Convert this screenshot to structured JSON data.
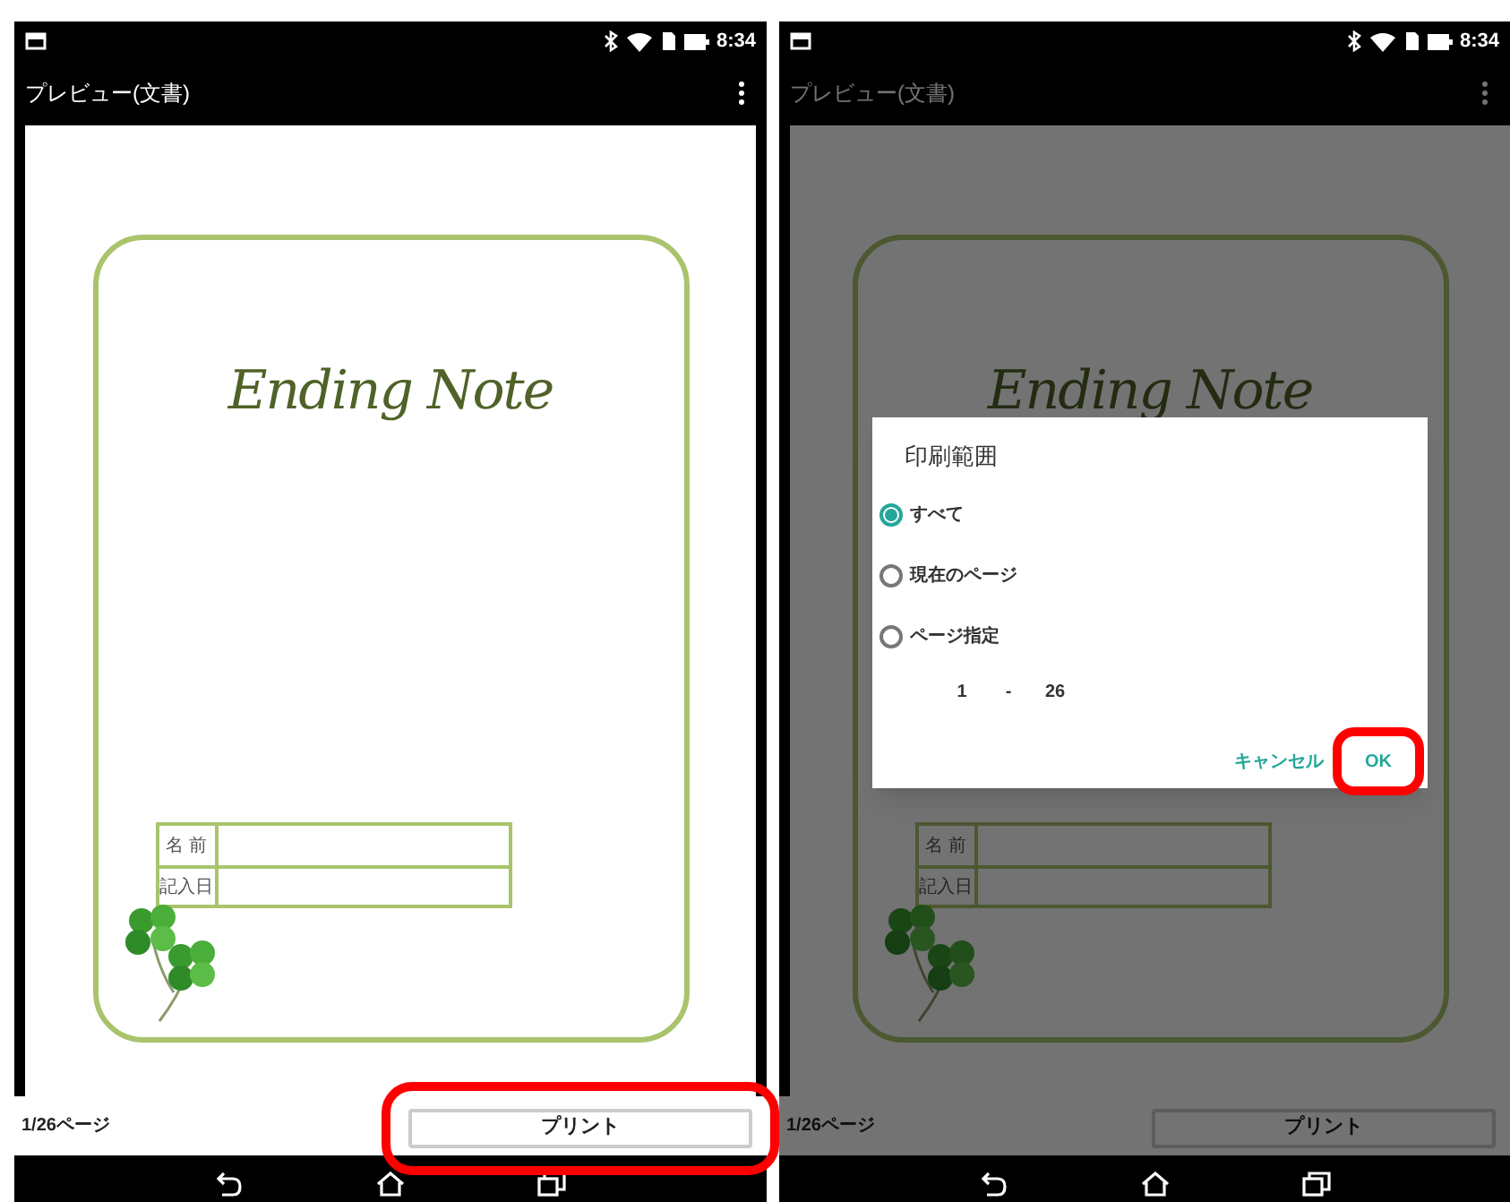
{
  "screens": [
    {
      "status_time": "8:34",
      "app_title": "プレビュー(文書)",
      "dimmed": false,
      "document": {
        "title": "Ending Note",
        "fields": [
          "名 前",
          "記入日"
        ]
      },
      "page_indicator": "1/26ページ",
      "print_button": {
        "label": "プリント",
        "highlighted": true
      }
    },
    {
      "status_time": "8:34",
      "app_title": "プレビュー(文書)",
      "dimmed": true,
      "document": {
        "title": "Ending Note",
        "fields": [
          "名 前",
          "記入日"
        ]
      },
      "page_indicator": "1/26ページ",
      "print_button": {
        "label": "プリント",
        "highlighted": false
      },
      "dialog": {
        "title": "印刷範囲",
        "options": [
          {
            "label": "すべて",
            "selected": true
          },
          {
            "label": "現在のページ",
            "selected": false
          },
          {
            "label": "ページ指定",
            "selected": false
          }
        ],
        "range": {
          "from": "1",
          "separator": "-",
          "to": "26"
        },
        "buttons": [
          {
            "label": "キャンセル",
            "highlighted": false
          },
          {
            "label": "OK",
            "highlighted": true
          }
        ]
      }
    }
  ]
}
